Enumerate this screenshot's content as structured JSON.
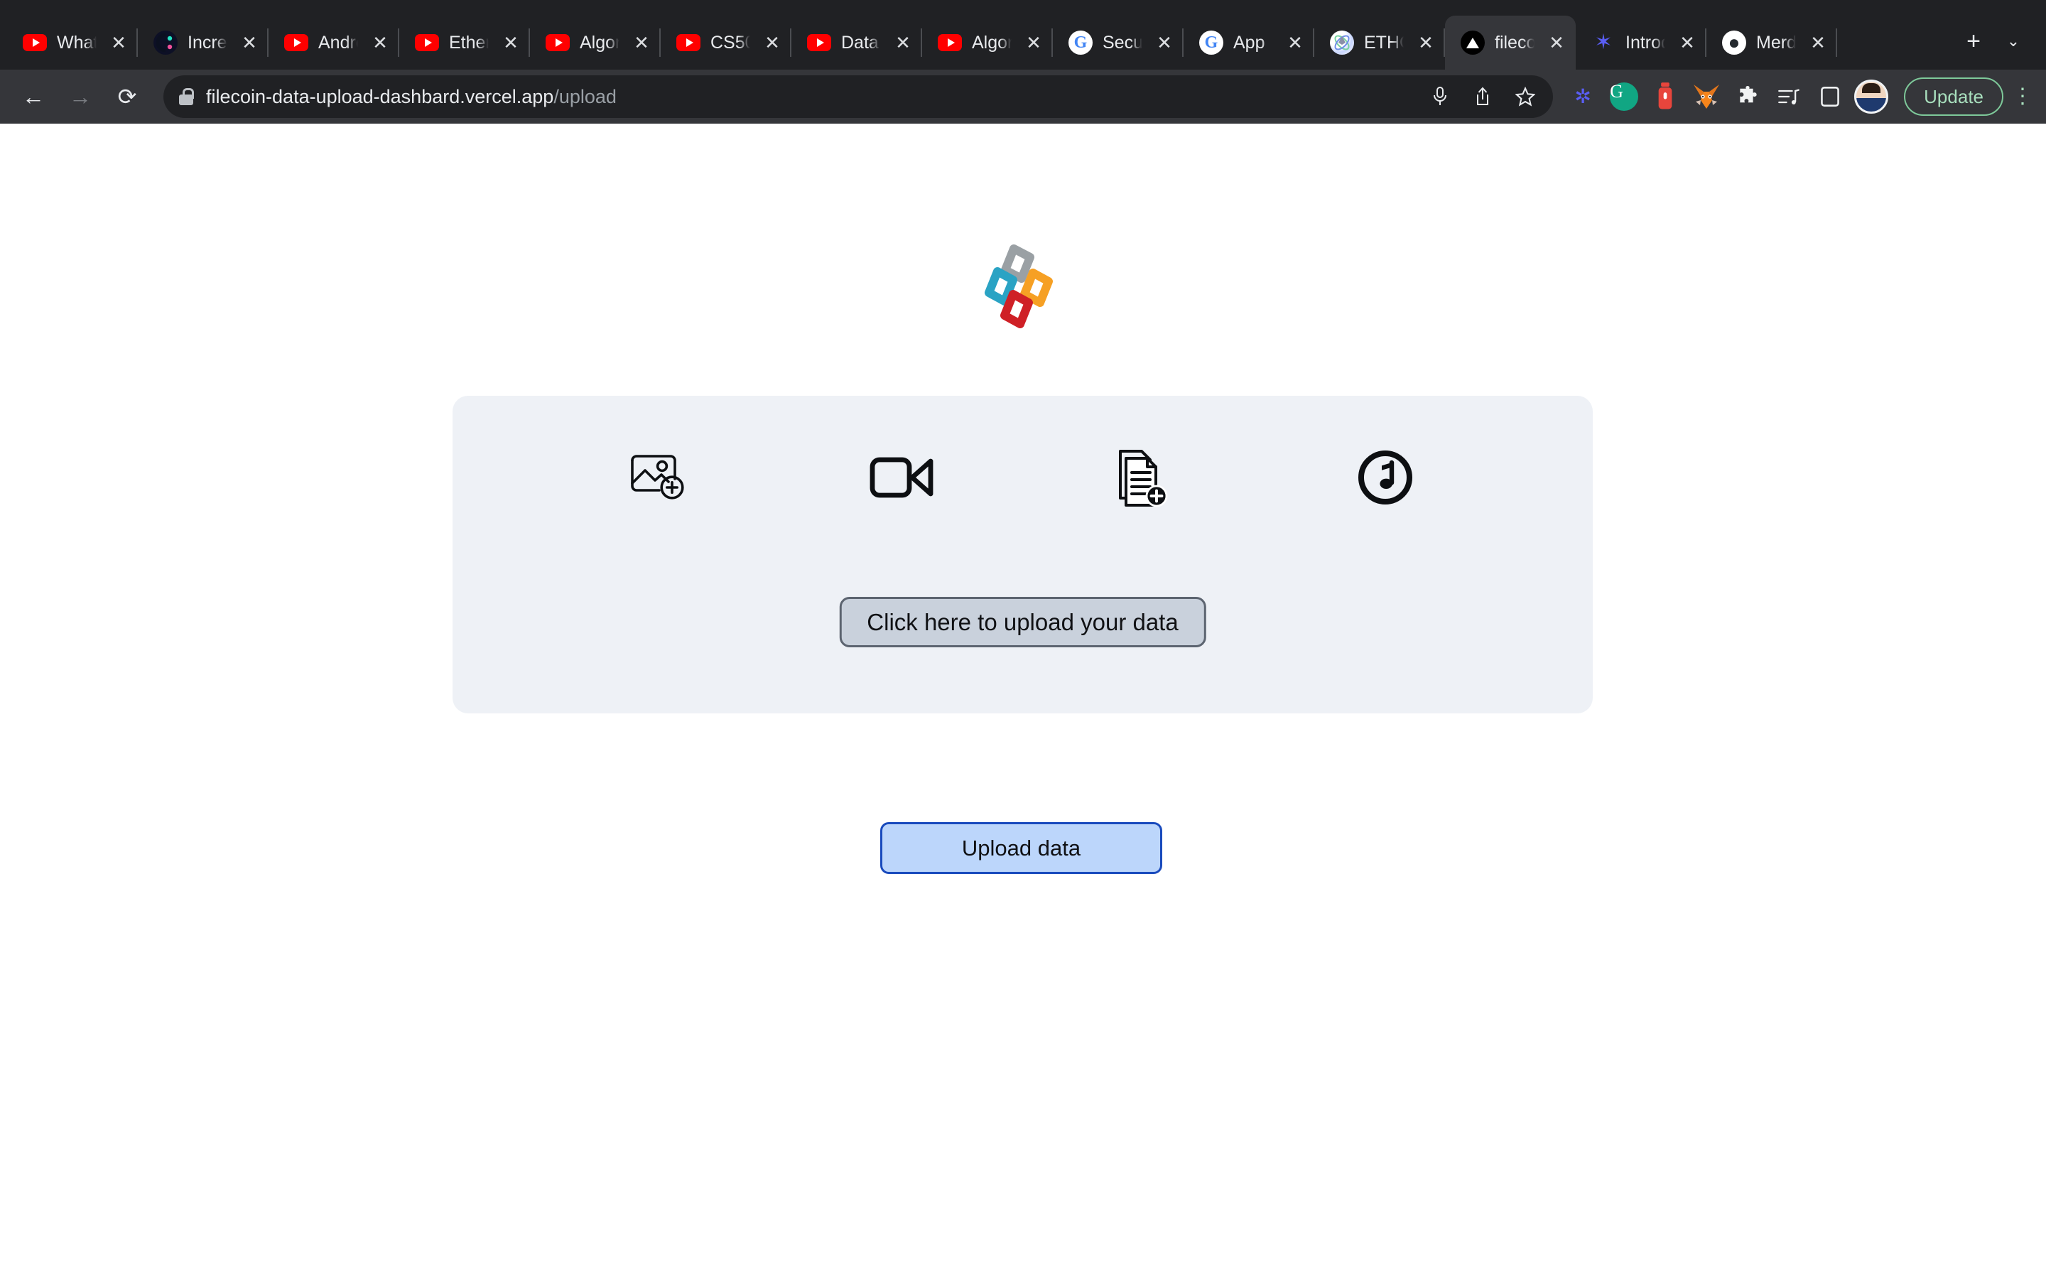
{
  "browser": {
    "tabs": [
      {
        "title": "What",
        "favicon": "youtube-icon",
        "active": false
      },
      {
        "title": "Incre",
        "favicon": "increment-icon",
        "active": false
      },
      {
        "title": "Andre",
        "favicon": "youtube-icon",
        "active": false
      },
      {
        "title": "Ether",
        "favicon": "youtube-icon",
        "active": false
      },
      {
        "title": "Algor",
        "favicon": "youtube-icon",
        "active": false
      },
      {
        "title": "CS50",
        "favicon": "youtube-icon",
        "active": false
      },
      {
        "title": "Data",
        "favicon": "youtube-icon",
        "active": false
      },
      {
        "title": "Algor",
        "favicon": "youtube-icon",
        "active": false
      },
      {
        "title": "Secu",
        "favicon": "google-icon",
        "active": false
      },
      {
        "title": "App",
        "favicon": "google-icon",
        "active": false
      },
      {
        "title": "ETHG",
        "favicon": "ethglobal-icon",
        "active": false
      },
      {
        "title": "fileco",
        "favicon": "vercel-icon",
        "active": true
      },
      {
        "title": "Introd",
        "favicon": "flower-icon",
        "active": false
      },
      {
        "title": "Merd",
        "favicon": "github-icon",
        "active": false
      }
    ],
    "new_tab_label": "+",
    "tab_list_label": "⌄",
    "close_label": "✕",
    "nav": {
      "back": "←",
      "forward": "→",
      "reload": "⟳"
    },
    "omnibox": {
      "lock": "lock-icon",
      "url_host": "filecoin-data-upload-dashbard.vercel.app",
      "url_path": "/upload",
      "mic": "🎤",
      "share": "⇪",
      "bookmark": "☆"
    },
    "extensions": [
      {
        "name": "flower-extension-icon",
        "glyph": "✳"
      },
      {
        "name": "grammarly-extension-icon",
        "glyph": "G"
      },
      {
        "name": "onepassword-extension-icon",
        "glyph": "▯"
      },
      {
        "name": "metamask-extension-icon",
        "glyph": "🦊"
      },
      {
        "name": "puzzle-extensions-icon",
        "glyph": "🧩"
      },
      {
        "name": "reading-list-icon",
        "glyph": "≡♪"
      },
      {
        "name": "side-panel-icon",
        "glyph": "▭"
      }
    ],
    "profile_avatar": "avatar",
    "update_label": "Update",
    "menu_label": "⋮"
  },
  "page": {
    "logo": {
      "name": "filecoin-diamonds-logo",
      "colors": {
        "gray": "#9aa0a4",
        "teal": "#2aa3c4",
        "orange": "#f6a024",
        "red": "#cf2026"
      }
    },
    "dropzone": {
      "background_color": "#eef1f6",
      "file_type_icons": [
        {
          "name": "image-add-icon",
          "label": "image"
        },
        {
          "name": "video-camera-icon",
          "label": "video"
        },
        {
          "name": "document-add-icon",
          "label": "document"
        },
        {
          "name": "music-note-icon",
          "label": "audio"
        }
      ],
      "pick_button_label": "Click here to upload your data"
    },
    "upload_button_label": "Upload data",
    "accent_colors": {
      "upload_button_fill": "#bcd6fb",
      "upload_button_border": "#1a4bbd",
      "pick_button_fill": "#c9d1dc",
      "pick_button_border": "#5c6470"
    }
  }
}
